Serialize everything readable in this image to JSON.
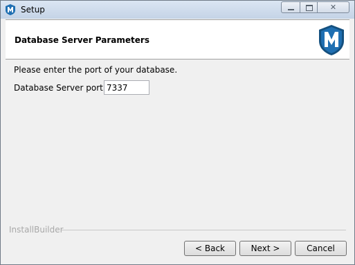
{
  "window": {
    "title": "Setup",
    "icon": "metasploit-logo-icon",
    "controls": {
      "minimize": "minimize-icon",
      "maximize": "maximize-icon",
      "close": "close-icon",
      "close_glyph": "✕"
    }
  },
  "header": {
    "title": "Database Server Parameters",
    "logo": "metasploit-shield-logo"
  },
  "content": {
    "description": "Please enter the port of your database.",
    "port_label": "Database Server port",
    "port_value": "7337"
  },
  "footer": {
    "brand": "InstallBuilder",
    "back_label": "< Back",
    "next_label": "Next >",
    "cancel_label": "Cancel"
  },
  "colors": {
    "logo_blue": "#1f6fb2",
    "logo_dark": "#14507f"
  }
}
